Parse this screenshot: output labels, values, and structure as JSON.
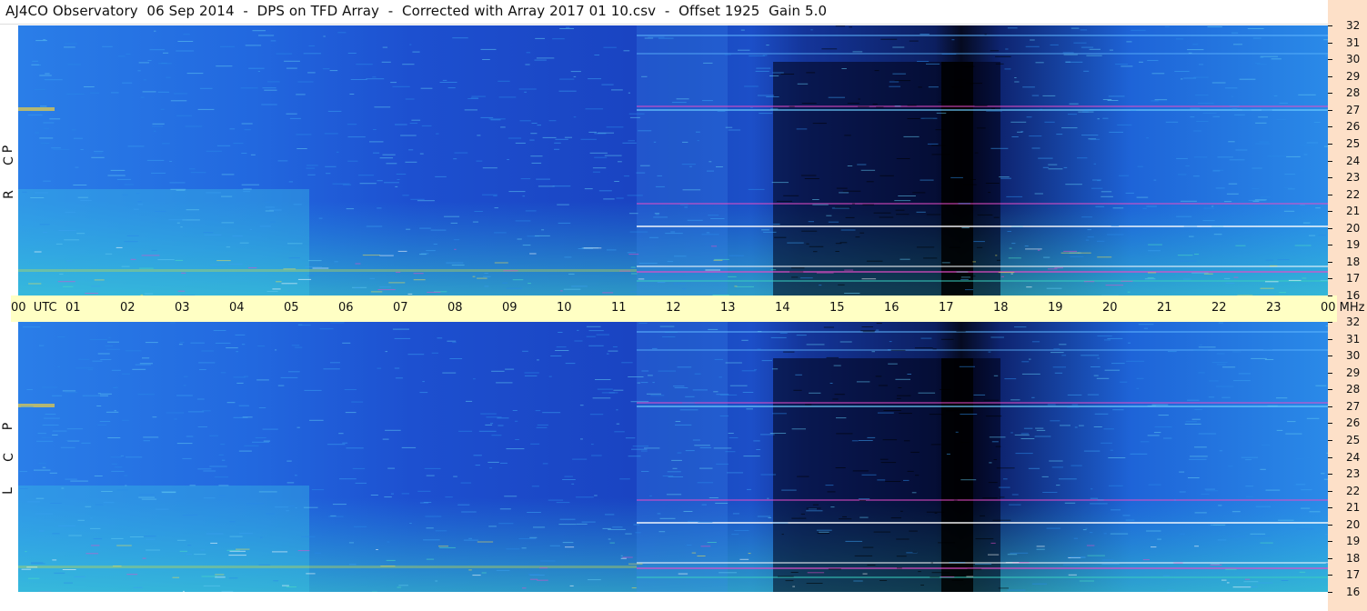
{
  "header": {
    "title": "AJ4CO Observatory  06 Sep 2014  -  DPS on TFD Array  -  Corrected with Array 2017 01 10.csv  -  Offset 1925  Gain 5.0"
  },
  "panels": [
    {
      "id": "rcp",
      "letters": [
        "R",
        "C",
        "P"
      ]
    },
    {
      "id": "lcp",
      "letters": [
        "L",
        "C",
        "P"
      ]
    }
  ],
  "chart_data": {
    "type": "heatmap",
    "title": "AJ4CO Observatory  06 Sep 2014  -  DPS on TFD Array  -  Corrected with Array 2017 01 10.csv  -  Offset 1925  Gain 5.0",
    "x": {
      "unit": "UTC",
      "range": [
        "00",
        "00"
      ],
      "tick_labels": [
        "00",
        "01",
        "02",
        "03",
        "04",
        "05",
        "06",
        "07",
        "08",
        "09",
        "10",
        "11",
        "12",
        "13",
        "14",
        "15",
        "16",
        "17",
        "18",
        "19",
        "20",
        "21",
        "22",
        "23",
        "00"
      ],
      "unit_label_after_first": "UTC"
    },
    "y": {
      "unit": "MHz",
      "range": [
        16,
        32
      ],
      "tick_labels": [
        "32",
        "31",
        "30",
        "29",
        "28",
        "27",
        "26",
        "25",
        "24",
        "23",
        "22",
        "21",
        "20",
        "19",
        "18",
        "17",
        "16"
      ],
      "unit_label_at_bottom": "MHz"
    },
    "panels": [
      "R C P",
      "L C P"
    ],
    "colors": {
      "low": "#000814",
      "background": "#1e5ad8",
      "mid": "#2b9be8",
      "high": "#00e0c0",
      "peak": "#e83cc8"
    }
  }
}
